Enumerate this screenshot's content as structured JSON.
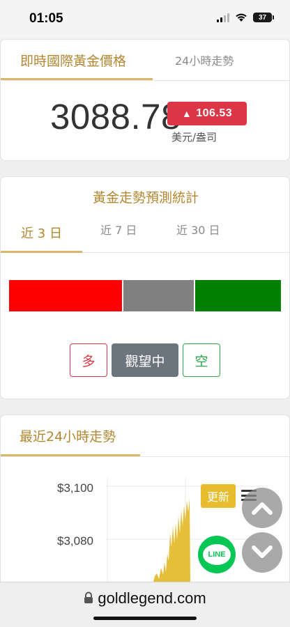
{
  "status": {
    "time": "01:05",
    "battery": "37"
  },
  "price_card": {
    "tab_active": "即時國際黃金價格",
    "tab_inactive": "24小時走勢",
    "price": "3088.78",
    "change": "106.53",
    "change_arrow": "▲",
    "unit": "美元/盎司"
  },
  "forecast": {
    "title": "黃金走勢預測統計",
    "tabs": [
      "近 3 日",
      "近 7 日",
      "近 30 日"
    ],
    "active_tab": 0,
    "bar_colors": {
      "bull": "#ff0000",
      "neutral": "#808080",
      "bear": "#008000"
    },
    "buttons": {
      "long": "多",
      "watch": "觀望中",
      "short": "空"
    }
  },
  "trend": {
    "title": "最近24小時走勢",
    "update_label": "更新",
    "chart_data": {
      "type": "area",
      "y_ticks": [
        "$3,100",
        "$3,080"
      ],
      "ylim": [
        3060,
        3100
      ],
      "color": "#e6bf3a"
    }
  },
  "floating": {
    "line_label": "LINE"
  },
  "browser": {
    "url": "goldlegend.com"
  },
  "colors": {
    "accent": "#b28730",
    "underline": "#d9b76a",
    "up": "#dc3545",
    "line_green": "#06c755"
  }
}
